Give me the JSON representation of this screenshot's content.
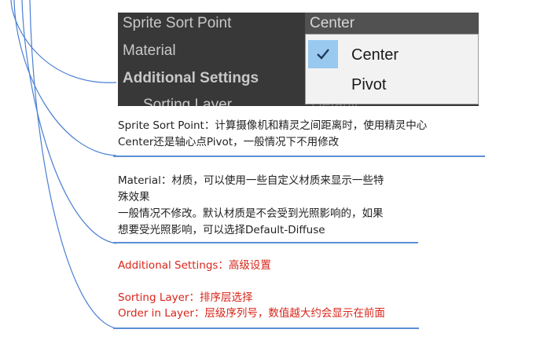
{
  "inspector": {
    "rows": {
      "sprite_sort_point": "Sprite Sort Point",
      "material": "Material",
      "additional_settings": "Additional Settings",
      "sorting_layer": "Sorting Layer"
    },
    "dropdown_value": "Center",
    "faded_value": "Default",
    "menu": {
      "items": [
        {
          "label": "Center",
          "checked": true
        },
        {
          "label": "Pivot",
          "checked": false
        }
      ]
    }
  },
  "notes": {
    "sprite_sort_point": {
      "line1": "Sprite Sort Point：计算摄像机和精灵之间距离时，使用精灵中心",
      "line2": "Center还是轴心点Pivot，一般情况下不用修改"
    },
    "material": {
      "line1": "Material：材质，可以使用一些自定义材质来显示一些特",
      "line2": "殊效果",
      "line3": "一般情况不修改。默认材质是不会受到光照影响的，如果",
      "line4": "想要受光照影响，可以选择Default-Diffuse"
    },
    "additional_settings": "Additional Settings：高级设置",
    "sorting_layer": "Sorting Layer：排序层选择",
    "order_in_layer": "Order in Layer：层级序列号，数值越大约会显示在前面"
  },
  "colors": {
    "connector": "#4a7fd4",
    "underline": "#5b8fd6",
    "highlight_text": "#d8261a",
    "check_highlight": "#99c9ef",
    "inspector_bg": "#383838"
  }
}
